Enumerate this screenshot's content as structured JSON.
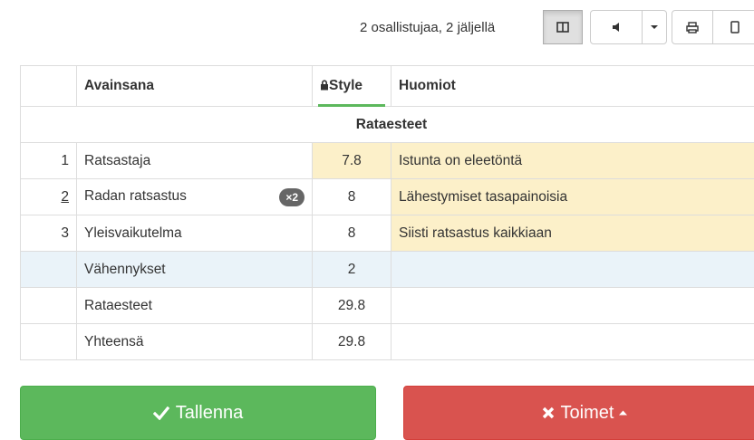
{
  "toolbar": {
    "participants": "2 osallistujaa, 2 jäljellä",
    "columns_icon": "columns-icon",
    "sound_icon": "volume-icon",
    "dropdown_icon": "caret-down-icon",
    "print_icon": "print-icon",
    "mobile_icon": "mobile-icon"
  },
  "table": {
    "headers": {
      "num": "",
      "keyword": "Avainsana",
      "style": "Style",
      "notes": "Huomiot"
    },
    "section": "Rataesteet",
    "rows": [
      {
        "num": "1",
        "keyword": "Ratsastaja",
        "score": "7.8",
        "note": "Istunta on eleetöntä"
      },
      {
        "num": "2",
        "keyword": "Radan ratsastus",
        "badge": "×2",
        "score": "8",
        "note": "Lähestymiset tasapainoisia"
      },
      {
        "num": "3",
        "keyword": "Yleisvaikutelma",
        "score": "8",
        "note": "Siisti ratsastus kaikkiaan"
      }
    ],
    "deductions": {
      "label": "Vähennykset",
      "score": "2"
    },
    "subtotal": {
      "label": "Rataesteet",
      "score": "29.8"
    },
    "total": {
      "label": "Yhteensä",
      "score": "29.8"
    }
  },
  "buttons": {
    "save": "Tallenna",
    "actions": "Toimet"
  },
  "colors": {
    "save": "#5cb85c",
    "actions": "#d9534f",
    "highlight": "#fcf0c9",
    "deduction": "#eaf3f9"
  }
}
